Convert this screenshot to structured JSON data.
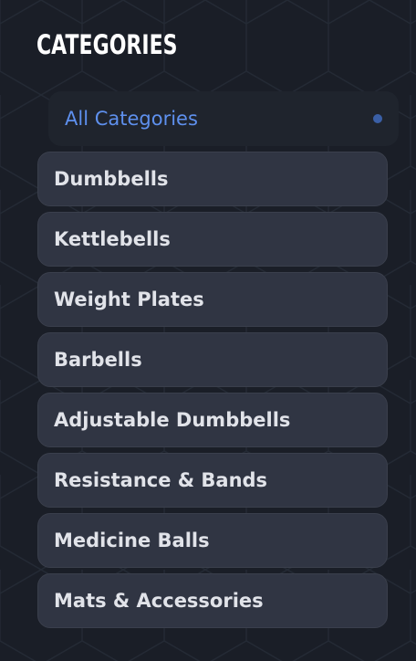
{
  "header": {
    "title": "CATEGORIES"
  },
  "active_item": {
    "label": "All Categories",
    "indicator_icon": "dot-icon"
  },
  "categories": [
    {
      "label": "Dumbbells"
    },
    {
      "label": "Kettlebells"
    },
    {
      "label": "Weight Plates"
    },
    {
      "label": "Barbells"
    },
    {
      "label": "Adjustable Dumbbells"
    },
    {
      "label": "Resistance & Bands"
    },
    {
      "label": "Medicine Balls"
    },
    {
      "label": "Mats & Accessories"
    }
  ],
  "colors": {
    "background": "#1a1e27",
    "accent": "#5e90ee",
    "item_background": "#303543",
    "active_background": "#1f242d",
    "text": "#e1e3e9",
    "title": "#ffffff"
  }
}
